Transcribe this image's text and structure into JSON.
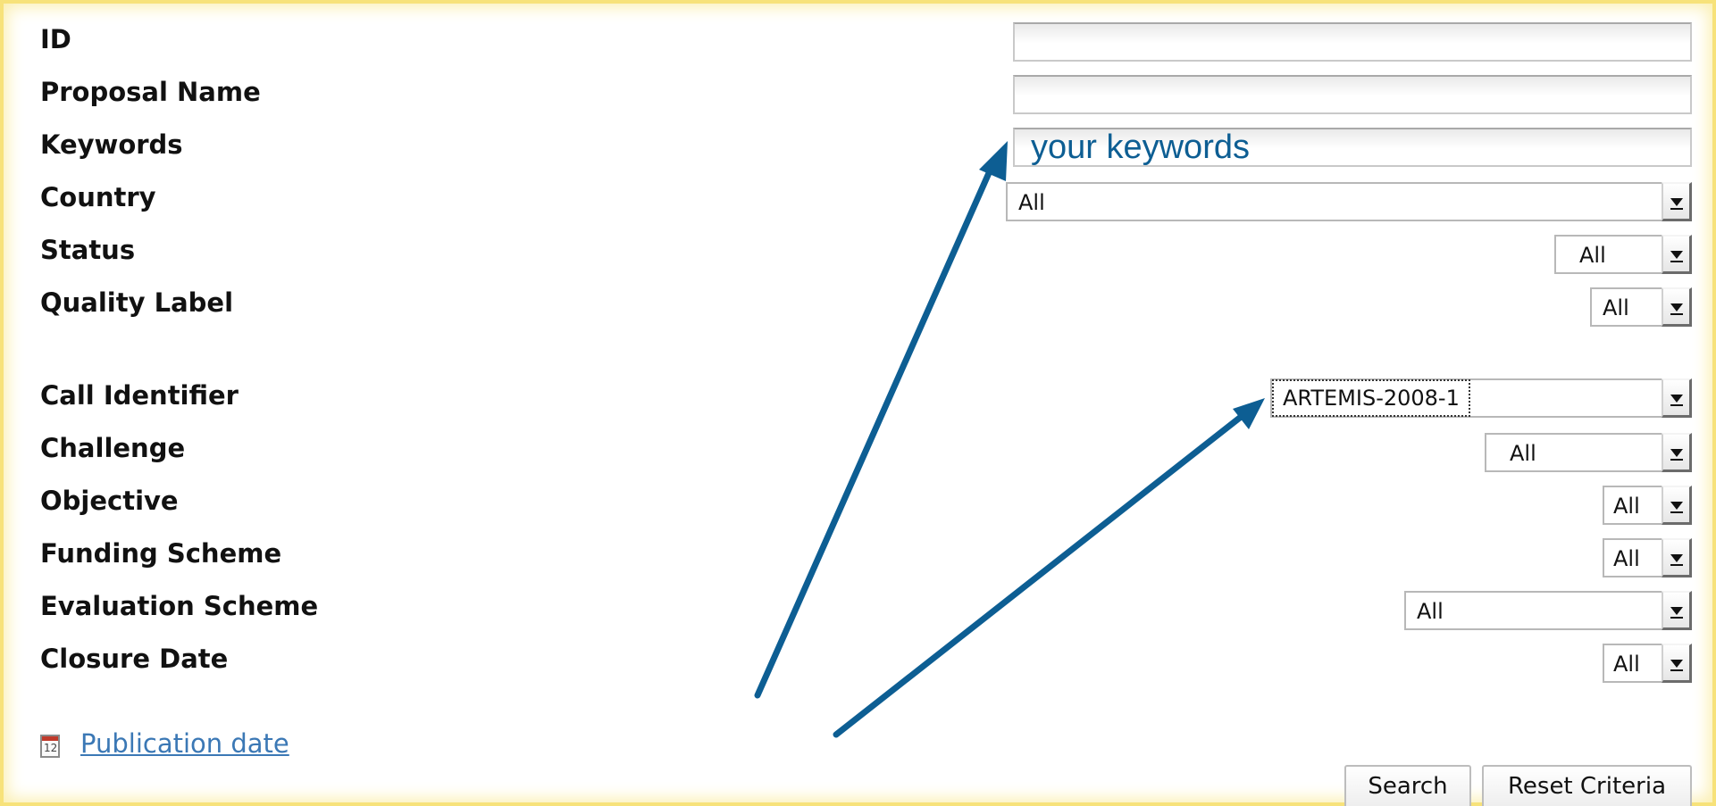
{
  "fields": {
    "id": "ID",
    "proposal_name": "Proposal Name",
    "keywords": "Keywords",
    "country": "Country",
    "status": "Status",
    "quality_label": "Quality Label",
    "call_identifier": "Call Identifier",
    "challenge": "Challenge",
    "objective": "Objective",
    "funding_scheme": "Funding Scheme",
    "evaluation_scheme": "Evaluation Scheme",
    "closure_date": "Closure Date"
  },
  "inputs": {
    "id_value": "",
    "proposal_name_value": "",
    "keywords_value": "your keywords"
  },
  "selects": {
    "country": "All",
    "status": "All",
    "quality_label": "All",
    "call_identifier": "ARTEMIS-2008-1",
    "challenge": "All",
    "objective": "All",
    "funding_scheme": "All",
    "evaluation_scheme": "All",
    "closure_date": "All"
  },
  "publication_date_link": "Publication date",
  "calendar_icon_text": "12",
  "buttons": {
    "search": "Search",
    "reset": "Reset Criteria"
  },
  "colors": {
    "annotation_arrow": "#0d5e93",
    "link": "#3b78b5",
    "frame": "#f7e27a"
  },
  "icons": [
    "calendar-icon",
    "dropdown-arrow-icon"
  ]
}
